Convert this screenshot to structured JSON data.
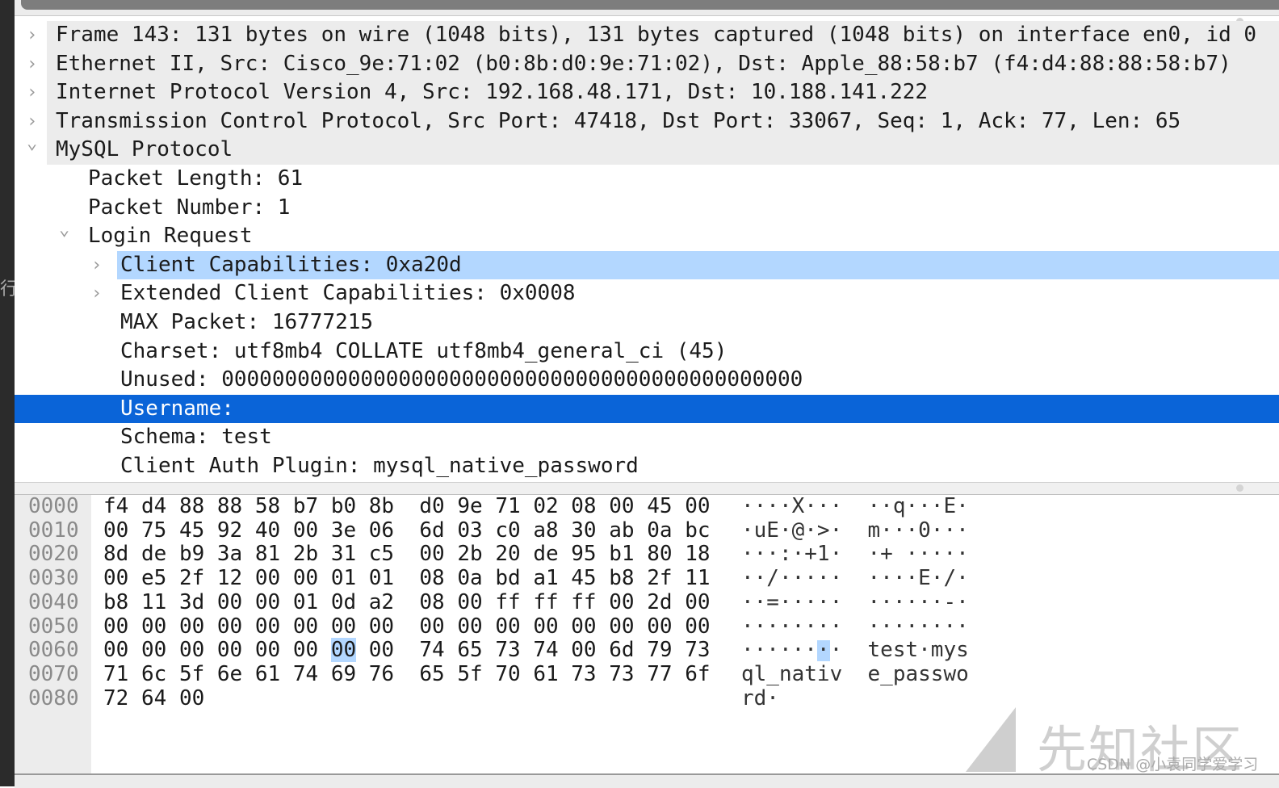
{
  "left_strip_glyph": "行",
  "tree": [
    {
      "level": 0,
      "expander": "collapsed",
      "text": "Frame 143: 131 bytes on wire (1048 bits), 131 bytes captured (1048 bits) on interface en0, id 0",
      "state": "top"
    },
    {
      "level": 0,
      "expander": "collapsed",
      "text": "Ethernet II, Src: Cisco_9e:71:02 (b0:8b:d0:9e:71:02), Dst: Apple_88:58:b7 (f4:d4:88:88:58:b7)",
      "state": "top"
    },
    {
      "level": 0,
      "expander": "collapsed",
      "text": "Internet Protocol Version 4, Src: 192.168.48.171, Dst: 10.188.141.222",
      "state": "top"
    },
    {
      "level": 0,
      "expander": "collapsed",
      "text": "Transmission Control Protocol, Src Port: 47418, Dst Port: 33067, Seq: 1, Ack: 77, Len: 65",
      "state": "top"
    },
    {
      "level": 0,
      "expander": "expanded",
      "text": "MySQL Protocol",
      "state": "top"
    },
    {
      "level": 1,
      "expander": "none",
      "text": "Packet Length: 61",
      "state": ""
    },
    {
      "level": 1,
      "expander": "none",
      "text": "Packet Number: 1",
      "state": ""
    },
    {
      "level": 1,
      "expander": "expanded",
      "text": "Login Request",
      "state": ""
    },
    {
      "level": 2,
      "expander": "collapsed",
      "text": "Client Capabilities: 0xa20d",
      "state": "hl"
    },
    {
      "level": 2,
      "expander": "collapsed",
      "text": "Extended Client Capabilities: 0x0008",
      "state": ""
    },
    {
      "level": 2,
      "expander": "none",
      "text": "MAX Packet: 16777215",
      "state": ""
    },
    {
      "level": 2,
      "expander": "none",
      "text": "Charset: utf8mb4 COLLATE utf8mb4_general_ci (45)",
      "state": ""
    },
    {
      "level": 2,
      "expander": "none",
      "text": "Unused: 0000000000000000000000000000000000000000000000",
      "state": ""
    },
    {
      "level": 2,
      "expander": "none",
      "text": "Username: ",
      "state": "sel"
    },
    {
      "level": 2,
      "expander": "none",
      "text": "Schema: test",
      "state": ""
    },
    {
      "level": 2,
      "expander": "none",
      "text": "Client Auth Plugin: mysql_native_password",
      "state": ""
    }
  ],
  "hex": [
    {
      "offset": "0000",
      "bytes": [
        "f4",
        "d4",
        "88",
        "88",
        "58",
        "b7",
        "b0",
        "8b",
        "d0",
        "9e",
        "71",
        "02",
        "08",
        "00",
        "45",
        "00"
      ],
      "ascii": "····X···  ··q···E·"
    },
    {
      "offset": "0010",
      "bytes": [
        "00",
        "75",
        "45",
        "92",
        "40",
        "00",
        "3e",
        "06",
        "6d",
        "03",
        "c0",
        "a8",
        "30",
        "ab",
        "0a",
        "bc"
      ],
      "ascii": "·uE·@·>·  m···0···"
    },
    {
      "offset": "0020",
      "bytes": [
        "8d",
        "de",
        "b9",
        "3a",
        "81",
        "2b",
        "31",
        "c5",
        "00",
        "2b",
        "20",
        "de",
        "95",
        "b1",
        "80",
        "18"
      ],
      "ascii": "···:·+1·  ·+ ·····"
    },
    {
      "offset": "0030",
      "bytes": [
        "00",
        "e5",
        "2f",
        "12",
        "00",
        "00",
        "01",
        "01",
        "08",
        "0a",
        "bd",
        "a1",
        "45",
        "b8",
        "2f",
        "11"
      ],
      "ascii": "··/·····  ····E·/·"
    },
    {
      "offset": "0040",
      "bytes": [
        "b8",
        "11",
        "3d",
        "00",
        "00",
        "01",
        "0d",
        "a2",
        "08",
        "00",
        "ff",
        "ff",
        "ff",
        "00",
        "2d",
        "00"
      ],
      "ascii": "··=·····  ······-·"
    },
    {
      "offset": "0050",
      "bytes": [
        "00",
        "00",
        "00",
        "00",
        "00",
        "00",
        "00",
        "00",
        "00",
        "00",
        "00",
        "00",
        "00",
        "00",
        "00",
        "00"
      ],
      "ascii": "········  ········"
    },
    {
      "offset": "0060",
      "bytes": [
        "00",
        "00",
        "00",
        "00",
        "00",
        "00",
        "00",
        "00",
        "74",
        "65",
        "73",
        "74",
        "00",
        "6d",
        "79",
        "73"
      ],
      "ascii": "········  test·mys",
      "highlight_byte": 6
    },
    {
      "offset": "0070",
      "bytes": [
        "71",
        "6c",
        "5f",
        "6e",
        "61",
        "74",
        "69",
        "76",
        "65",
        "5f",
        "70",
        "61",
        "73",
        "73",
        "77",
        "6f"
      ],
      "ascii": "ql_nativ  e_passwo"
    },
    {
      "offset": "0080",
      "bytes": [
        "72",
        "64",
        "00"
      ],
      "ascii": "rd·"
    }
  ],
  "colors": {
    "selection": "#0a64d8",
    "highlight": "#b3d7ff",
    "header_row": "#ececec"
  },
  "watermark": {
    "logo_text": "先知社区",
    "credit": "CSDN @小袁同学爱学习"
  }
}
